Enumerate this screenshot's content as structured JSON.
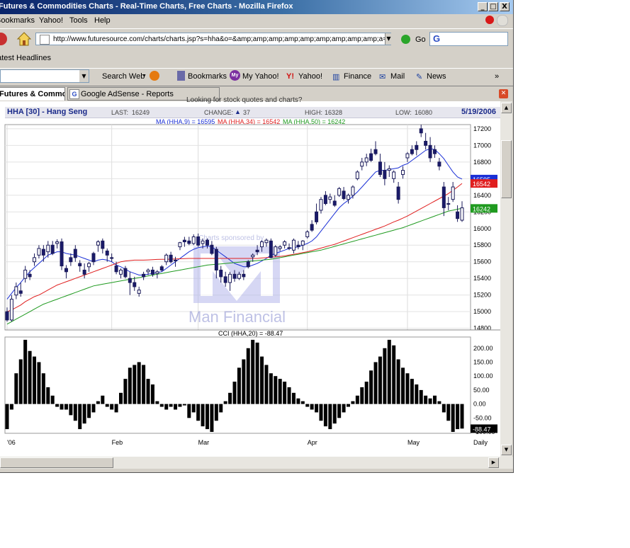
{
  "window": {
    "title": "Futures & Commodities Charts - Real-Time Charts, Free Charts - Mozilla Firefox",
    "min": "_",
    "max": "□",
    "close": "X"
  },
  "menu": [
    "Bookmarks",
    "Yahoo!",
    "Tools",
    "Help"
  ],
  "nav": {
    "url": "http://www.futuresource.com/charts/charts.jsp?s=hha&o=&amp;amp;amp;amp;amp;amp;amp;amp;amp;a=D",
    "go_label": "Go",
    "search_letter": "G"
  },
  "headlines_label": "Latest Headlines",
  "yahoo_toolbar": {
    "search_web": "Search Web",
    "items": [
      "Bookmarks",
      "My Yahoo!",
      "Yahoo!",
      "Finance",
      "Mail",
      "News"
    ],
    "more": "»"
  },
  "tabs": [
    {
      "label": "Futures & Commodities Charts",
      "active": true
    },
    {
      "label": "Google AdSense - Reports",
      "active": false
    }
  ],
  "page": {
    "partial_link": "Looking for stock quotes and charts?",
    "header": {
      "symbol": "HHA [30] - Hang Seng",
      "last_label": "LAST:",
      "last": "16249",
      "change_label": "CHANGE:",
      "change": "37",
      "high_label": "HIGH:",
      "high": "16328",
      "low_label": "LOW:",
      "low": "16080",
      "date": "5/19/2006"
    },
    "ma_legend": [
      {
        "text": "MA (HHA,9) = 16595",
        "color": "#1a2fd6"
      },
      {
        "text": "MA (HHA,34) = 16542",
        "color": "#e01f1f"
      },
      {
        "text": "MA (HHA,50) = 16242",
        "color": "#1f9a1f"
      }
    ],
    "watermark_top": "Charts sponsored by",
    "watermark_brand": "Man Financial",
    "cci_legend": "CCI (HHA,20) = -88.47"
  },
  "chart_data": {
    "type": "candlestick",
    "price_axis": {
      "ticks": [
        14800,
        15000,
        15200,
        15400,
        15600,
        15800,
        16000,
        16200,
        16400,
        16600,
        16800,
        17000,
        17200
      ],
      "ylim": [
        14780,
        17250
      ]
    },
    "price_tags": [
      {
        "value": "16595",
        "color": "#1a2fd6"
      },
      {
        "value": "16542",
        "color": "#e01f1f"
      },
      {
        "value": "16242",
        "color": "#1f9a1f"
      }
    ],
    "x_labels": [
      "'06",
      "Feb",
      "Mar",
      "Apr",
      "May",
      "Daily"
    ],
    "candles": [
      [
        15000,
        15050,
        14880,
        14900
      ],
      [
        14900,
        15200,
        14880,
        15150
      ],
      [
        15200,
        15350,
        15150,
        15300
      ],
      [
        15250,
        15350,
        15180,
        15220
      ],
      [
        15400,
        15550,
        15350,
        15500
      ],
      [
        15450,
        15500,
        15380,
        15420
      ],
      [
        15600,
        15700,
        15550,
        15650
      ],
      [
        15680,
        15800,
        15640,
        15760
      ],
      [
        15750,
        15800,
        15600,
        15680
      ],
      [
        15720,
        15850,
        15650,
        15800
      ],
      [
        15800,
        15850,
        15680,
        15700
      ],
      [
        15820,
        15870,
        15760,
        15840
      ],
      [
        15840,
        15880,
        15500,
        15550
      ],
      [
        15520,
        15560,
        15400,
        15480
      ],
      [
        15650,
        15700,
        15550,
        15600
      ],
      [
        15750,
        15800,
        15600,
        15650
      ],
      [
        15580,
        15620,
        15480,
        15550
      ],
      [
        15500,
        15580,
        15400,
        15450
      ],
      [
        15540,
        15600,
        15480,
        15580
      ],
      [
        15700,
        15720,
        15560,
        15600
      ],
      [
        15800,
        15860,
        15720,
        15840
      ],
      [
        15850,
        15880,
        15700,
        15760
      ],
      [
        15730,
        15760,
        15600,
        15680
      ],
      [
        15650,
        15700,
        15600,
        15640
      ],
      [
        15550,
        15600,
        15450,
        15480
      ],
      [
        15450,
        15520,
        15400,
        15500
      ],
      [
        15520,
        15550,
        15400,
        15420
      ],
      [
        15400,
        15480,
        15200,
        15350
      ],
      [
        15350,
        15420,
        15250,
        15300
      ],
      [
        15220,
        15300,
        15180,
        15260
      ],
      [
        15450,
        15480,
        15380,
        15420
      ],
      [
        15480,
        15520,
        15440,
        15500
      ],
      [
        15500,
        15540,
        15420,
        15450
      ],
      [
        15460,
        15500,
        15400,
        15480
      ],
      [
        15540,
        15560,
        15480,
        15500
      ],
      [
        15600,
        15700,
        15560,
        15680
      ],
      [
        15680,
        15720,
        15580,
        15600
      ],
      [
        15620,
        15660,
        15540,
        15620
      ],
      [
        15780,
        15840,
        15740,
        15830
      ],
      [
        15860,
        15900,
        15780,
        15840
      ],
      [
        15850,
        15900,
        15800,
        15820
      ],
      [
        15820,
        15930,
        15800,
        15900
      ],
      [
        15900,
        15940,
        15780,
        15800
      ],
      [
        15820,
        15880,
        15760,
        15850
      ],
      [
        15860,
        15880,
        15760,
        15800
      ],
      [
        15800,
        15850,
        15680,
        15700
      ],
      [
        15750,
        15780,
        15400,
        15500
      ],
      [
        15500,
        15550,
        15350,
        15420
      ],
      [
        15420,
        15480,
        15300,
        15350
      ],
      [
        15350,
        15480,
        15250,
        15450
      ],
      [
        15450,
        15500,
        15360,
        15400
      ],
      [
        15400,
        15480,
        15380,
        15450
      ],
      [
        15450,
        15500,
        15380,
        15420
      ],
      [
        15600,
        15620,
        15520,
        15540
      ],
      [
        15660,
        15700,
        15600,
        15680
      ],
      [
        15740,
        15800,
        15680,
        15720
      ],
      [
        15780,
        15860,
        15720,
        15840
      ],
      [
        15830,
        15880,
        15780,
        15860
      ],
      [
        15850,
        15880,
        15640,
        15650
      ],
      [
        15680,
        15800,
        15660,
        15780
      ],
      [
        15760,
        15800,
        15730,
        15780
      ],
      [
        15800,
        15860,
        15760,
        15840
      ],
      [
        15770,
        15820,
        15740,
        15760
      ],
      [
        15740,
        15880,
        15700,
        15860
      ],
      [
        15800,
        15850,
        15750,
        15780
      ],
      [
        15800,
        15860,
        15740,
        15850
      ],
      [
        15900,
        15980,
        15880,
        15960
      ],
      [
        16050,
        16100,
        15960,
        15980
      ],
      [
        16200,
        16300,
        16050,
        16080
      ],
      [
        16220,
        16380,
        16180,
        16350
      ],
      [
        16400,
        16450,
        16280,
        16300
      ],
      [
        16350,
        16420,
        16300,
        16380
      ],
      [
        16330,
        16400,
        16260,
        16280
      ],
      [
        16400,
        16500,
        16380,
        16480
      ],
      [
        16450,
        16500,
        16340,
        16360
      ],
      [
        16350,
        16420,
        16300,
        16400
      ],
      [
        16400,
        16520,
        16360,
        16500
      ],
      [
        16600,
        16700,
        16580,
        16680
      ],
      [
        16750,
        16850,
        16700,
        16800
      ],
      [
        16800,
        16900,
        16750,
        16850
      ],
      [
        16900,
        16960,
        16800,
        16820
      ],
      [
        16950,
        17050,
        16880,
        16900
      ],
      [
        16800,
        16900,
        16620,
        16650
      ],
      [
        16700,
        16800,
        16520,
        16600
      ],
      [
        16700,
        16760,
        16620,
        16720
      ],
      [
        16600,
        16700,
        16550,
        16680
      ],
      [
        16500,
        16560,
        16300,
        16350
      ],
      [
        16650,
        16750,
        16600,
        16700
      ],
      [
        16850,
        16920,
        16800,
        16900
      ],
      [
        16950,
        17000,
        16880,
        16900
      ],
      [
        17000,
        17050,
        16880,
        16950
      ],
      [
        17200,
        17250,
        17100,
        17150
      ],
      [
        17050,
        17150,
        16950,
        17000
      ],
      [
        17000,
        17100,
        16800,
        16850
      ],
      [
        16950,
        17000,
        16850,
        16900
      ],
      [
        16800,
        16850,
        16700,
        16750
      ],
      [
        16500,
        16560,
        16150,
        16250
      ],
      [
        16300,
        16380,
        16220,
        16300
      ],
      [
        16350,
        16560,
        16320,
        16500
      ],
      [
        16200,
        16280,
        16080,
        16120
      ],
      [
        16100,
        16328,
        16080,
        16249
      ]
    ],
    "ma9": [
      15150,
      15220,
      15290,
      15350,
      15420,
      15480,
      15530,
      15580,
      15630,
      15680,
      15700,
      15720,
      15720,
      15700,
      15690,
      15680,
      15660,
      15640,
      15620,
      15600,
      15620,
      15630,
      15620,
      15600,
      15560,
      15540,
      15510,
      15480,
      15460,
      15440,
      15440,
      15450,
      15460,
      15470,
      15480,
      15520,
      15560,
      15600,
      15640,
      15680,
      15720,
      15750,
      15770,
      15780,
      15790,
      15780,
      15740,
      15700,
      15660,
      15620,
      15580,
      15560,
      15540,
      15540,
      15560,
      15580,
      15610,
      15640,
      15680,
      15700,
      15720,
      15740,
      15760,
      15770,
      15780,
      15800,
      15820,
      15850,
      15900,
      15970,
      16040,
      16110,
      16180,
      16250,
      16300,
      16340,
      16390,
      16440,
      16500,
      16560,
      16620,
      16680,
      16700,
      16700,
      16710,
      16720,
      16730,
      16760,
      16780,
      16820,
      16860,
      16900,
      16940,
      16960,
      16950,
      16900,
      16840,
      16760,
      16680,
      16620,
      16595
    ],
    "ma34": [
      15000,
      15020,
      15050,
      15080,
      15120,
      15150,
      15180,
      15200,
      15230,
      15260,
      15290,
      15320,
      15340,
      15360,
      15380,
      15400,
      15420,
      15440,
      15460,
      15480,
      15500,
      15520,
      15540,
      15560,
      15580,
      15600,
      15610,
      15615,
      15620,
      15620,
      15620,
      15622,
      15625,
      15628,
      15630,
      15630,
      15632,
      15634,
      15636,
      15638,
      15640,
      15640,
      15640,
      15640,
      15640,
      15640,
      15640,
      15640,
      15640,
      15640,
      15640,
      15640,
      15640,
      15640,
      15640,
      15640,
      15645,
      15650,
      15655,
      15660,
      15665,
      15670,
      15680,
      15690,
      15700,
      15710,
      15720,
      15735,
      15750,
      15765,
      15780,
      15795,
      15810,
      15830,
      15850,
      15870,
      15890,
      15910,
      15930,
      15950,
      15970,
      15990,
      16010,
      16030,
      16055,
      16080,
      16100,
      16125,
      16150,
      16180,
      16210,
      16240,
      16270,
      16300,
      16330,
      16360,
      16390,
      16420,
      16460,
      16500,
      16542
    ],
    "ma50": [
      14850,
      14880,
      14910,
      14940,
      14970,
      15000,
      15030,
      15060,
      15090,
      15110,
      15130,
      15150,
      15170,
      15190,
      15210,
      15230,
      15250,
      15270,
      15290,
      15310,
      15320,
      15330,
      15340,
      15350,
      15360,
      15370,
      15380,
      15390,
      15400,
      15410,
      15420,
      15430,
      15440,
      15450,
      15460,
      15470,
      15480,
      15490,
      15500,
      15510,
      15520,
      15530,
      15540,
      15550,
      15560,
      15565,
      15570,
      15575,
      15580,
      15585,
      15590,
      15595,
      15600,
      15605,
      15610,
      15615,
      15620,
      15625,
      15630,
      15640,
      15650,
      15660,
      15670,
      15680,
      15690,
      15700,
      15710,
      15720,
      15730,
      15740,
      15755,
      15770,
      15785,
      15800,
      15815,
      15830,
      15845,
      15860,
      15875,
      15890,
      15905,
      15920,
      15935,
      15950,
      15965,
      15980,
      15995,
      16010,
      16030,
      16050,
      16070,
      16090,
      16110,
      16130,
      16150,
      16170,
      16190,
      16210,
      16220,
      16232,
      16242
    ],
    "cci_axis": {
      "ticks": [
        200,
        150,
        100,
        50,
        0,
        -50,
        -100
      ],
      "ylim": [
        -105,
        240
      ]
    },
    "cci_current": "-88.47",
    "cci": [
      -90,
      -20,
      110,
      160,
      230,
      190,
      170,
      150,
      110,
      60,
      30,
      -10,
      -20,
      -20,
      -40,
      -60,
      -90,
      -70,
      -50,
      -30,
      10,
      30,
      -10,
      -20,
      -30,
      40,
      90,
      130,
      140,
      150,
      140,
      90,
      70,
      10,
      -10,
      -20,
      -10,
      -20,
      -10,
      -5,
      -50,
      -30,
      -60,
      -80,
      -90,
      -100,
      -60,
      -30,
      10,
      40,
      80,
      130,
      160,
      200,
      230,
      220,
      170,
      140,
      110,
      100,
      90,
      80,
      60,
      40,
      20,
      10,
      -10,
      -20,
      -30,
      -60,
      -80,
      -90,
      -70,
      -50,
      -30,
      -10,
      10,
      30,
      60,
      80,
      120,
      150,
      170,
      200,
      230,
      210,
      160,
      130,
      110,
      90,
      70,
      50,
      30,
      20,
      30,
      10,
      -30,
      -60,
      -100,
      -90,
      -88
    ]
  }
}
